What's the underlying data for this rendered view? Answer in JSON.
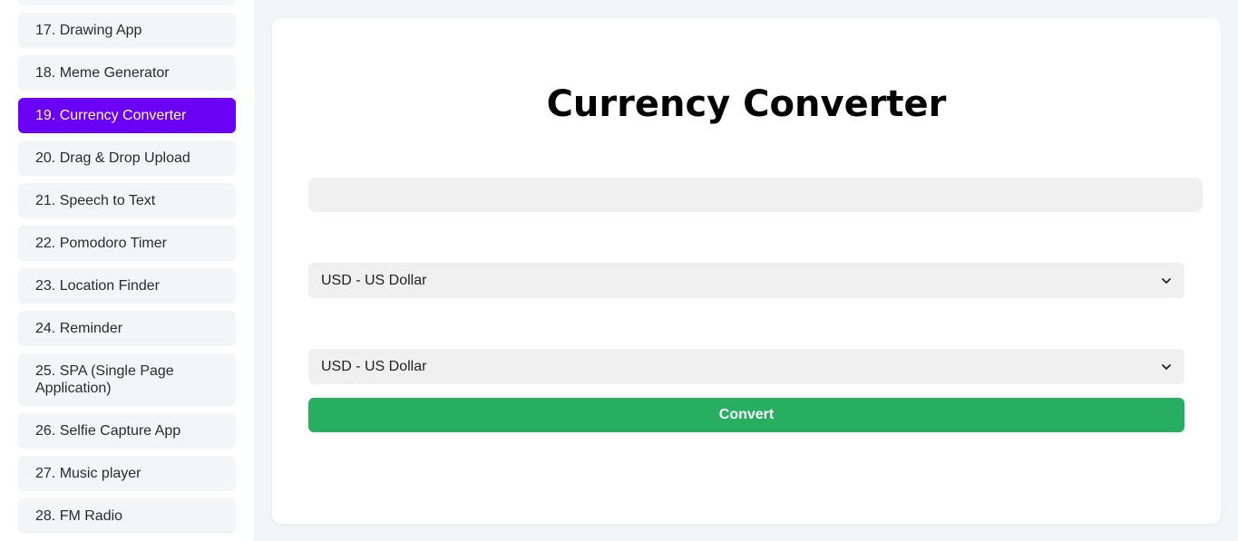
{
  "sidebar": {
    "items": [
      {
        "label": "17. Drawing App"
      },
      {
        "label": "18. Meme Generator"
      },
      {
        "label": "19. Currency Converter",
        "active": true
      },
      {
        "label": "20. Drag & Drop Upload"
      },
      {
        "label": "21. Speech to Text"
      },
      {
        "label": "22. Pomodoro Timer"
      },
      {
        "label": "23. Location Finder"
      },
      {
        "label": "24. Reminder"
      },
      {
        "label": "25. SPA (Single Page Application)"
      },
      {
        "label": "26. Selfie Capture App"
      },
      {
        "label": "27. Music player"
      },
      {
        "label": "28. FM Radio"
      }
    ]
  },
  "main": {
    "title": "Currency Converter",
    "amount_value": "",
    "from_currency": "USD - US Dollar",
    "to_currency": "USD - US Dollar",
    "convert_label": "Convert"
  },
  "colors": {
    "active": "#6a00f4",
    "convert": "#27ae60",
    "background": "#f4f5f7"
  },
  "icons": {
    "select_chevron": "chevron-down-icon"
  }
}
